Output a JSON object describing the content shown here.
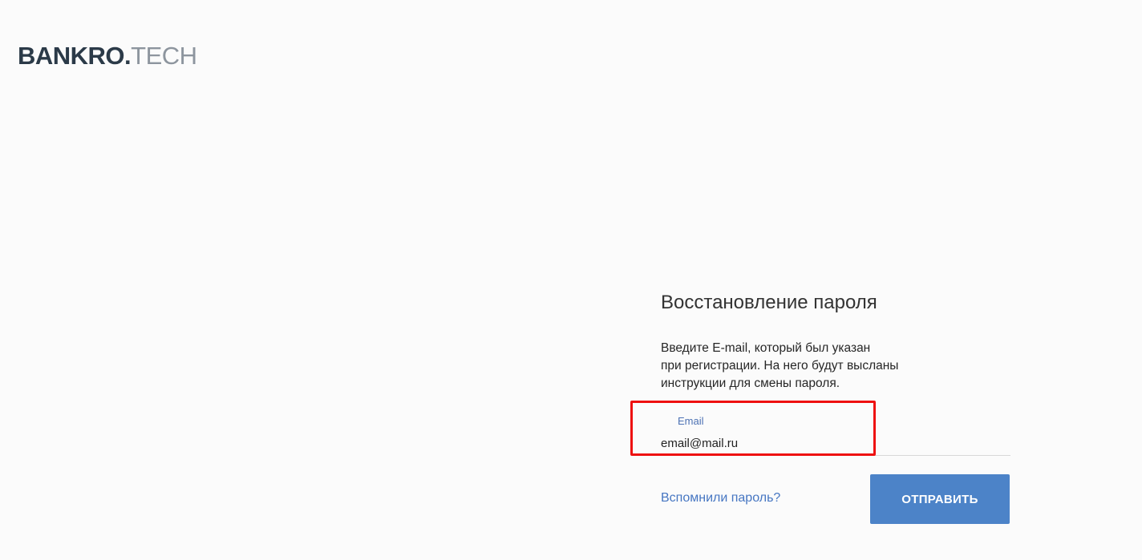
{
  "logo": {
    "main": "BANKRO.",
    "accent": "TECH"
  },
  "form": {
    "title": "Восстановление пароля",
    "description_lines": [
      "Введите E-mail, который был указан",
      "при регистрации. На него будут высланы",
      "инструкции для смены пароля."
    ],
    "email": {
      "label": "Email",
      "value": "email@mail.ru"
    },
    "remember_link": "Вспомнили пароль?",
    "submit_label": "ОТПРАВИТЬ"
  },
  "colors": {
    "background": "#fbfbfb",
    "logo_main": "#2b3a48",
    "logo_accent": "#8d959e",
    "link": "#4676c2",
    "button": "#4c83c8",
    "highlight_border": "#ee1010"
  }
}
